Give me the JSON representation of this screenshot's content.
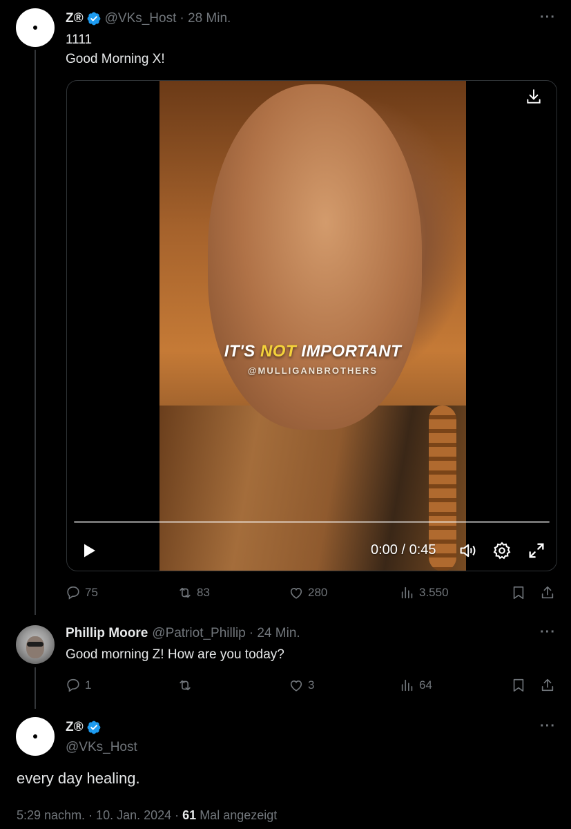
{
  "tweet1": {
    "name": "Z®",
    "handle": "@VKs_Host",
    "time": "· 28 Min.",
    "text": "1111\nGood Morning X!",
    "media": {
      "caption_pre": "IT'S ",
      "caption_highlight": "NOT",
      "caption_post": " IMPORTANT",
      "caption_sub": "@MULLIGANBROTHERS",
      "time_display": "0:00 / 0:45",
      "progress": 0
    },
    "actions": {
      "replies": "75",
      "reposts": "83",
      "likes": "280",
      "views": "3.550"
    }
  },
  "tweet2": {
    "name": "Phillip Moore",
    "handle": "@Patriot_Phillip",
    "time": "· 24 Min.",
    "text": "Good morning Z! How are you today?",
    "actions": {
      "replies": "1",
      "reposts": "",
      "likes": "3",
      "views": "64"
    }
  },
  "tweet3": {
    "name": "Z®",
    "handle": "@VKs_Host",
    "text": "every day healing.",
    "timestamp": "5:29 nachm. · 10. Jan. 2024 · ",
    "views_count": "61",
    "views_label": " Mal angezeigt"
  },
  "more_glyph": "···",
  "colors": {
    "verified": "#1d9bf0",
    "muted": "#71767b",
    "text": "#e7e9ea",
    "bg": "#000000"
  }
}
